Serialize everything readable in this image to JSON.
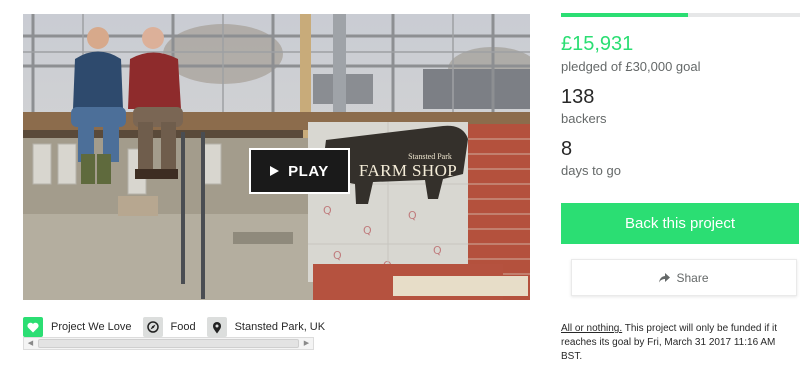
{
  "video": {
    "play_label": "PLAY",
    "sign_small": "Stansted Park",
    "sign_big": "FARM SHOP"
  },
  "tags": {
    "love": "Project We Love",
    "category": "Food",
    "location": "Stansted Park, UK"
  },
  "stats": {
    "progress_fraction": 0.531,
    "pledged": "£15,931",
    "pledged_sub": "pledged of £30,000 goal",
    "backers": "138",
    "backers_sub": "backers",
    "days": "8",
    "days_sub": "days to go"
  },
  "actions": {
    "back_label": "Back this project",
    "share_label": "Share"
  },
  "funding_note": {
    "link": "All or nothing.",
    "text": " This project will only be funded if it reaches its goal by Fri, March 31 2017 11:16 AM BST."
  },
  "icons": {
    "heart": "heart-icon",
    "category": "compass-icon",
    "location": "map-pin-icon",
    "share": "share-arrow-icon"
  },
  "colors": {
    "accent": "#2bde73",
    "muted_text": "#656969",
    "text": "#282828"
  }
}
